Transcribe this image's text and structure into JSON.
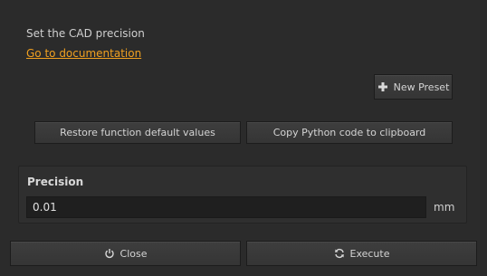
{
  "header": {
    "description": "Set the CAD precision",
    "doc_link": "Go to documentation"
  },
  "toolbar": {
    "new_preset_label": "New Preset",
    "restore_label": "Restore function default values",
    "copy_label": "Copy Python code to clipboard"
  },
  "form": {
    "group_title": "Precision",
    "precision_value": "0.01",
    "unit": "mm"
  },
  "footer": {
    "close_label": "Close",
    "execute_label": "Execute"
  },
  "icons": {
    "new_preset": "plus-icon",
    "close": "power-icon",
    "execute": "refresh-icon"
  },
  "colors": {
    "background": "#2b2b2b",
    "link": "#f0a020",
    "button": "#3a3a3a",
    "field": "#1f1f1f"
  }
}
